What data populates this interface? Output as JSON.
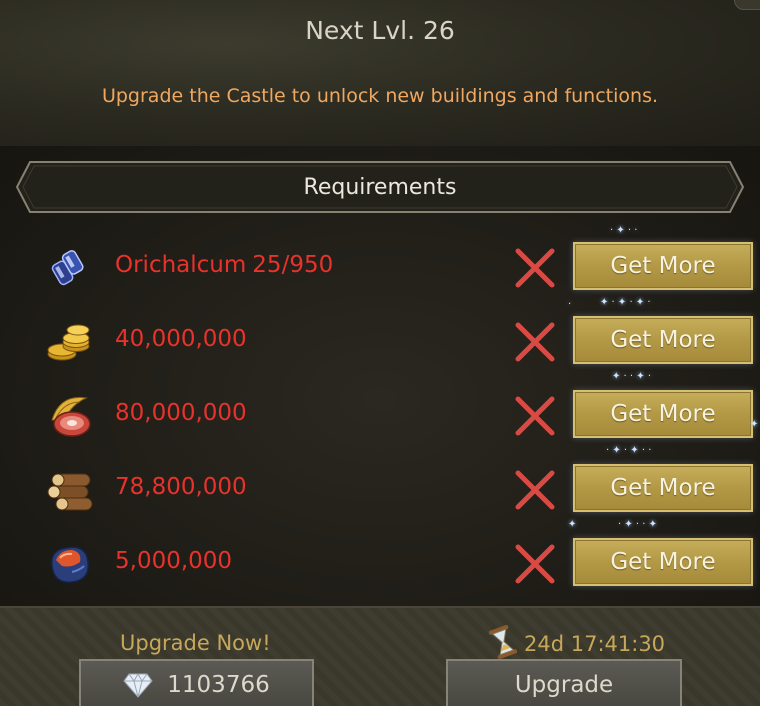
{
  "header": {
    "next_level": "Next Lvl. 26",
    "description": "Upgrade the Castle to unlock new buildings and functions."
  },
  "requirements": {
    "title": "Requirements",
    "items": [
      {
        "icon": "orichalcum-icon",
        "name": "Orichalcum",
        "amount": "25/950",
        "met": false,
        "button": "Get More"
      },
      {
        "icon": "gold-coins-icon",
        "name": "",
        "amount": "40,000,000",
        "met": false,
        "button": "Get More"
      },
      {
        "icon": "food-meat-icon",
        "name": "",
        "amount": "80,000,000",
        "met": false,
        "button": "Get More"
      },
      {
        "icon": "wood-logs-icon",
        "name": "",
        "amount": "78,800,000",
        "met": false,
        "button": "Get More"
      },
      {
        "icon": "ore-stone-icon",
        "name": "",
        "amount": "5,000,000",
        "met": false,
        "button": "Get More"
      }
    ]
  },
  "footer": {
    "upgrade_now_label": "Upgrade Now!",
    "gem_cost": "1103766",
    "timer": "24d 17:41:30",
    "upgrade_label": "Upgrade"
  },
  "colors": {
    "missing_red": "#e8322b",
    "gold_button": "#b39945",
    "accent_orange": "#f0a860",
    "footer_gold": "#c7a85a"
  }
}
